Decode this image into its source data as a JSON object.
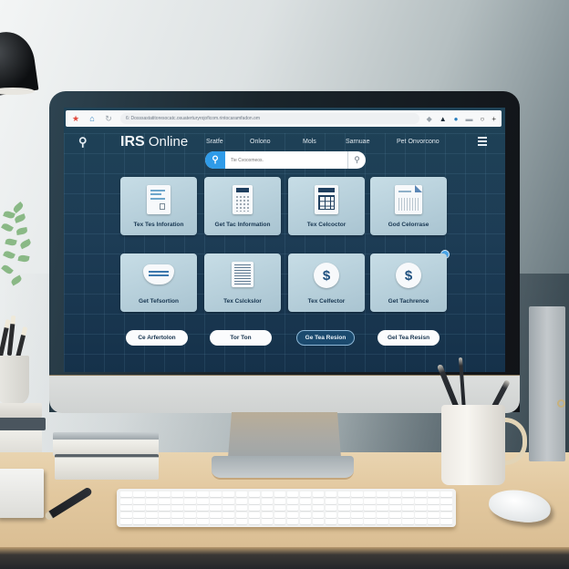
{
  "browser": {
    "url": "6: Dosssastatitoresocatc.osuaterturyrojoficom.rintocaramfadon.om",
    "left_icons": [
      "bookmark-star-icon",
      "home-icon",
      "reload-icon"
    ],
    "right_icons": [
      "extension-icon",
      "account-icon",
      "profile-icon",
      "minimize-icon",
      "maximize-icon",
      "add-tab-icon"
    ]
  },
  "site": {
    "logo_bold": "IRS",
    "logo_rest": " Online",
    "nav_links": [
      "Sratfe",
      "Onlono",
      "Mols",
      "Sarnuae",
      "Pet Onvorcono"
    ],
    "search": {
      "placeholder": "Tie Cvooxmeos."
    },
    "cards": [
      {
        "label": "Tex Tes Inforation",
        "icon": "document-icon"
      },
      {
        "label": "Get Tac Information",
        "icon": "calculator-icon"
      },
      {
        "label": "Tex Celcoctor",
        "icon": "calculator-grid-icon"
      },
      {
        "label": "God Celorrase",
        "icon": "form-document-icon"
      },
      {
        "label": "Get Tefsortion",
        "icon": "shield-chart-icon"
      },
      {
        "label": "Tex Cslckslor",
        "icon": "receipt-icon"
      },
      {
        "label": "Tex Celfector",
        "icon": "dollar-icon"
      },
      {
        "label": "Get Tachrence",
        "icon": "dollar-icon"
      }
    ],
    "buttons": [
      {
        "label": "Ce Arfertolon",
        "style": "light"
      },
      {
        "label": "Tor Ton",
        "style": "light"
      },
      {
        "label": "Ge Tea Resion",
        "style": "dark"
      },
      {
        "label": "Gel Tea Resisn",
        "style": "light"
      }
    ]
  },
  "colors": {
    "accent": "#2f9be8",
    "screen_bg": "#1d3c55",
    "card_bg": "#b8d0db",
    "label_text": "#173651"
  }
}
